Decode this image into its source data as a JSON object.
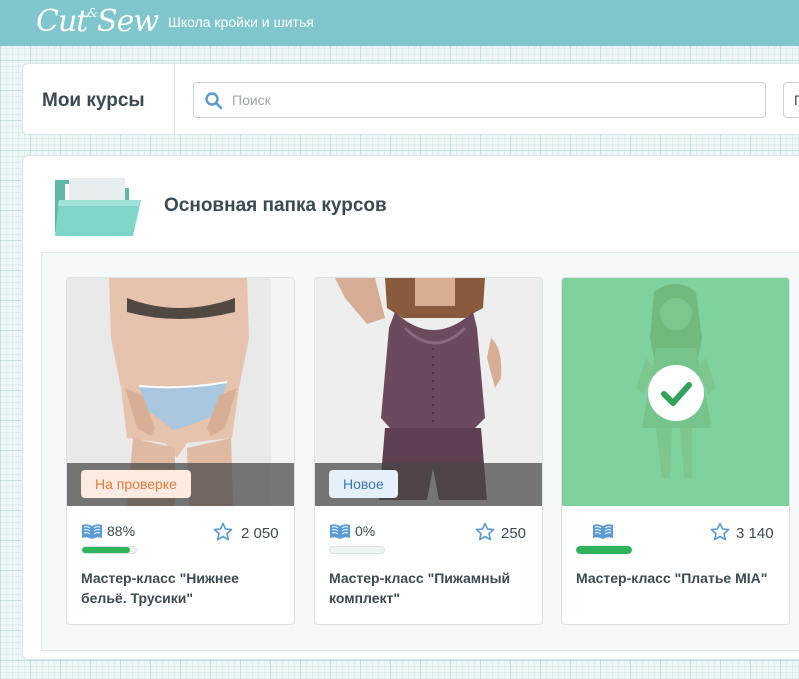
{
  "app": {
    "logo_main": "Cut",
    "logo_amp": "&",
    "logo_second": "Sew",
    "tagline": "Школа кройки и шитья"
  },
  "header": {
    "title": "Мои курсы",
    "search_placeholder": "Поиск",
    "search_value": "",
    "extra_button_partial": "П"
  },
  "folder": {
    "title": "Основная папка курсов",
    "icon": "folder-icon"
  },
  "courses": [
    {
      "title": "Мастер-класс \"Нижнее бельё. Трусики\"",
      "badge": "На проверке",
      "progress_text": "88%",
      "progress": 0.88,
      "rating": "2 050",
      "completed": false
    },
    {
      "title": "Мастер-класс \"Пижамный комплект\"",
      "badge": "Новое",
      "progress_text": "0%",
      "progress": 0,
      "rating": "250",
      "completed": false
    },
    {
      "title": "Мастер-класс \"Платье MIA\"",
      "badge": "",
      "progress_text": "",
      "progress": 1,
      "rating": "3 140",
      "completed": true
    }
  ],
  "colors": {
    "topbar": "#7fc6cd",
    "accent_green": "#2fb35a",
    "badge_review_text": "#e27b3a",
    "badge_new_text": "#3c78b8",
    "icon_blue": "#5a9bd5"
  }
}
